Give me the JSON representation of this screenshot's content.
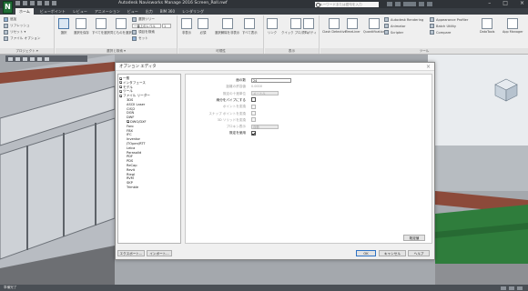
{
  "app": {
    "logo": "N",
    "window_title": "Autodesk Navisworks Manage 2016  Screen_Roll.nwf",
    "search_placeholder": "キーワードまたは語句を入力",
    "window_controls": [
      "–",
      "□",
      "×"
    ]
  },
  "tabs": [
    {
      "label": "ホーム",
      "active": true
    },
    {
      "label": "ビューポイント",
      "active": false
    },
    {
      "label": "レビュー",
      "active": false
    },
    {
      "label": "アニメーション",
      "active": false
    },
    {
      "label": "ビュー",
      "active": false
    },
    {
      "label": "出力",
      "active": false
    },
    {
      "label": "BIM 360",
      "active": false
    },
    {
      "label": "レンダリング",
      "active": false
    }
  ],
  "ribbon": {
    "groups": [
      {
        "label": "プロジェクト ▾"
      },
      {
        "label": "選択と検索 ▾"
      },
      {
        "label": "可視性"
      },
      {
        "label": "表示"
      },
      {
        "label": "ツール"
      }
    ],
    "buttons": {
      "append": "追加",
      "refresh": "リフレッシュ",
      "reset": "リセット ▾",
      "file_options": "ファイル オプション",
      "select": "選択",
      "save_selection": "選択を保存",
      "select_all": "すべてを選択",
      "select_same": "同じものを選択",
      "selection_tree": "選択ツリー",
      "find_items": "項目を検索",
      "quick_find": "クイック検索",
      "sets": "セット",
      "hide": "非表示",
      "require": "必須",
      "hide_unselected": "選択解除を非表示",
      "unhide_all": "すべて表示",
      "links": "リンク",
      "quick_properties": "クイック プロパティ",
      "properties": "プロパティ",
      "clash": "Clash Detective",
      "timeliner": "TimeLiner",
      "quantification": "Quantification",
      "animator": "Animator",
      "scripter": "Scripter",
      "autodesk_rendering": "Autodesk Rendering",
      "appearance_profiler": "Appearance Profiler",
      "batch_utility": "Batch Utility",
      "compare": "Compare",
      "datatools": "DataTools",
      "app_manager": "App Manager"
    },
    "dropdowns": {
      "selection_mode": "一番上のレベル",
      "value_field": "1"
    }
  },
  "viewport": {
    "wall_color": "#b8bcc2",
    "beam_color": "#8c4a3a",
    "green_color": "#2f7d3c",
    "sky_color": "#e9ecef"
  },
  "dialog": {
    "title": "オプション エディタ",
    "close": "×",
    "tree": [
      {
        "label": "一般",
        "level": 0,
        "expand": true
      },
      {
        "label": "インタフェース",
        "level": 0,
        "expand": true
      },
      {
        "label": "モデル",
        "level": 0,
        "expand": true
      },
      {
        "label": "ツール",
        "level": 0,
        "expand": true
      },
      {
        "label": "ファイル リーダー",
        "level": 0,
        "expand": true
      },
      {
        "label": "3DS",
        "level": 1
      },
      {
        "label": "ASCII Laser",
        "level": 1
      },
      {
        "label": "CIS/2",
        "level": 1
      },
      {
        "label": "DGN",
        "level": 1
      },
      {
        "label": "DWF",
        "level": 1
      },
      {
        "label": "DWG/DXF",
        "level": 1,
        "expand": true
      },
      {
        "label": "Faro",
        "level": 1
      },
      {
        "label": "FBX",
        "level": 1
      },
      {
        "label": "IFC",
        "level": 1
      },
      {
        "label": "Inventor",
        "level": 1
      },
      {
        "label": "JTOpen/RTT",
        "level": 1
      },
      {
        "label": "Leica",
        "level": 1
      },
      {
        "label": "Parasolid",
        "level": 1
      },
      {
        "label": "PDF",
        "level": 1
      },
      {
        "label": "PDS",
        "level": 1
      },
      {
        "label": "ReCap",
        "level": 1
      },
      {
        "label": "Revit",
        "level": 1
      },
      {
        "label": "Riegl",
        "level": 1
      },
      {
        "label": "RVM",
        "level": 1
      },
      {
        "label": "SKP",
        "level": 1
      },
      {
        "label": "Trimble",
        "level": 1
      }
    ],
    "settings": [
      {
        "label": "面の数",
        "type": "text",
        "value": "24"
      },
      {
        "label": "距離の許容値",
        "type": "value",
        "value": "0.0000",
        "disabled": true
      },
      {
        "label": "既定の十進単位",
        "type": "select",
        "value": "メートル",
        "disabled": true
      },
      {
        "label": "線分をパイプにする",
        "type": "check",
        "checked": false
      },
      {
        "label": "ポイントを変換",
        "type": "check",
        "checked": false,
        "disabled": true
      },
      {
        "label": "スナップ ポイントを変換",
        "type": "check",
        "checked": false,
        "disabled": true
      },
      {
        "label": "3D ソリッドを変換",
        "type": "check",
        "checked": false,
        "disabled": true
      },
      {
        "label": "プロキシ表示",
        "type": "select",
        "value": "自動",
        "disabled": true
      },
      {
        "label": "既定を使用",
        "type": "check",
        "checked": true
      }
    ],
    "default_button": "既定値",
    "footer_left": [
      "エクスポート...",
      "インポート..."
    ],
    "footer_right": [
      "OK",
      "キャンセル",
      "ヘルプ"
    ]
  },
  "statusbar": {
    "text": "準備完了"
  }
}
